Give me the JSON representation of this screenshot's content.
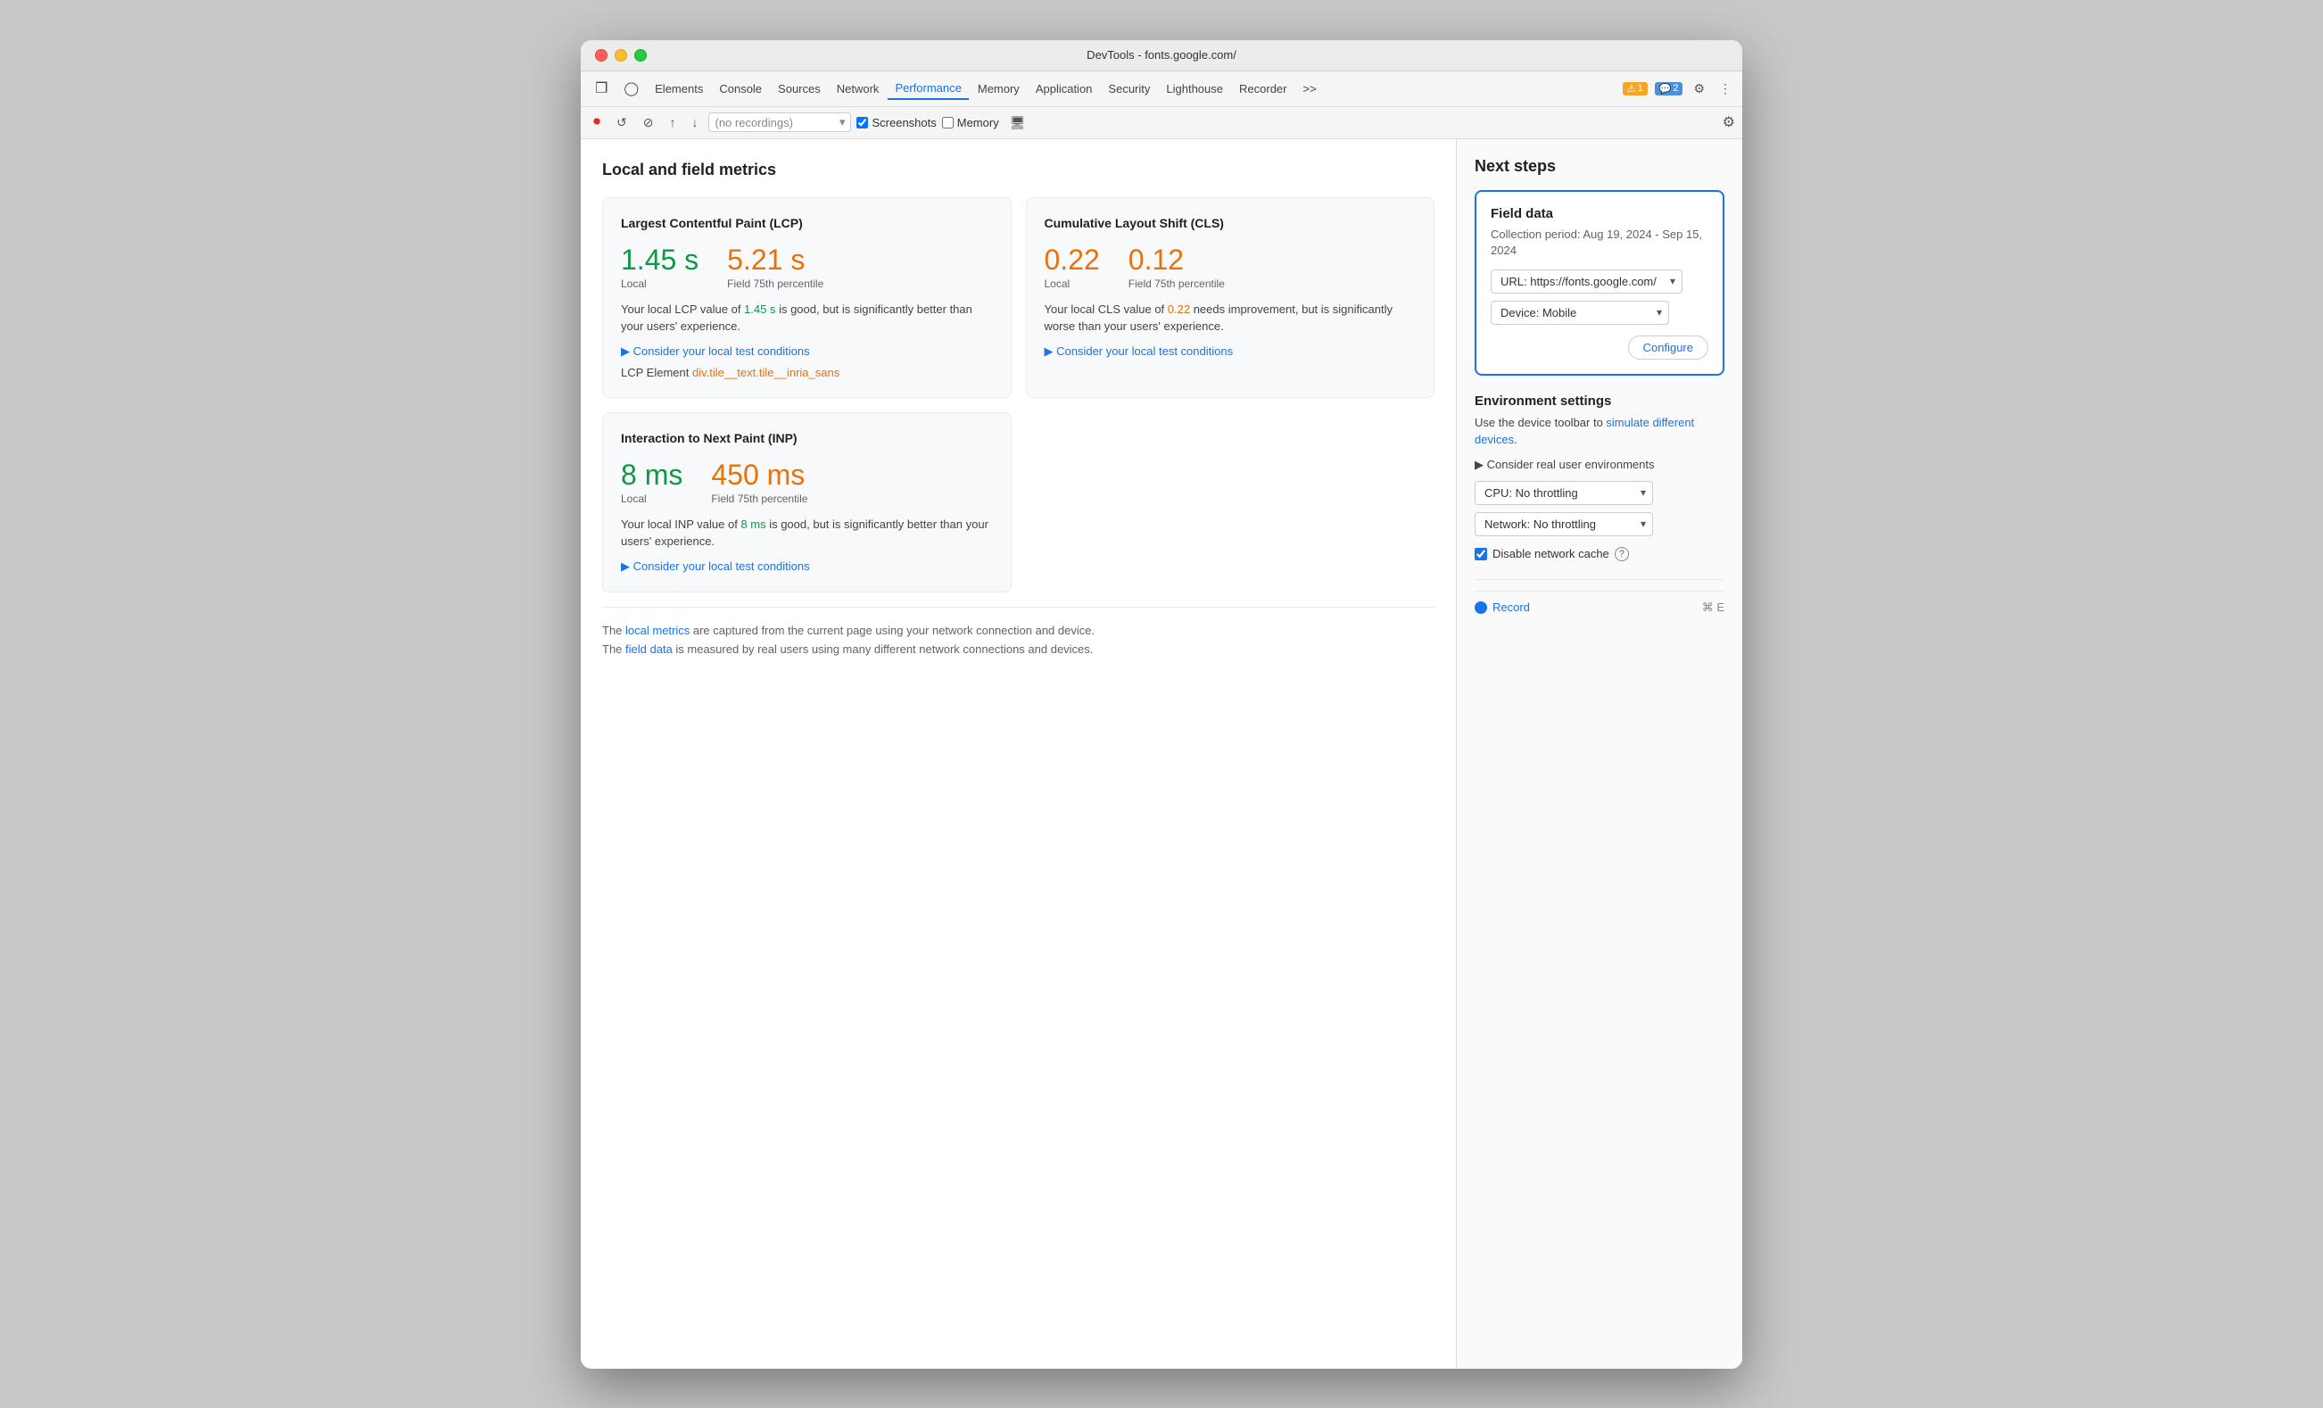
{
  "window": {
    "title": "DevTools - fonts.google.com/"
  },
  "titlebar": {
    "title": "DevTools - fonts.google.com/"
  },
  "toolbar": {
    "tabs": [
      {
        "id": "elements",
        "label": "Elements",
        "active": false
      },
      {
        "id": "console",
        "label": "Console",
        "active": false
      },
      {
        "id": "sources",
        "label": "Sources",
        "active": false
      },
      {
        "id": "network",
        "label": "Network",
        "active": false
      },
      {
        "id": "performance",
        "label": "Performance",
        "active": true
      },
      {
        "id": "memory",
        "label": "Memory",
        "active": false
      },
      {
        "id": "application",
        "label": "Application",
        "active": false
      },
      {
        "id": "security",
        "label": "Security",
        "active": false
      },
      {
        "id": "lighthouse",
        "label": "Lighthouse",
        "active": false
      },
      {
        "id": "recorder",
        "label": "Recorder",
        "active": false
      }
    ],
    "overflow": ">>",
    "warning_count": "1",
    "info_count": "2"
  },
  "controls": {
    "record_placeholder": "(no recordings)",
    "screenshots_label": "Screenshots",
    "screenshots_checked": true,
    "memory_label": "Memory",
    "memory_checked": false
  },
  "left_panel": {
    "section_title": "Local and field metrics",
    "lcp_card": {
      "title": "Largest Contentful Paint (LCP)",
      "local_value": "1.45 s",
      "local_label": "Local",
      "field_value": "5.21 s",
      "field_label": "Field 75th percentile",
      "description_start": "Your local LCP value of ",
      "description_highlight": "1.45 s",
      "description_end": " is good, but is significantly better than your users' experience.",
      "expand_label": "▶ Consider your local test conditions",
      "lcp_element_prefix": "LCP Element ",
      "lcp_element_value": "div.tile__text.tile__inria_sans"
    },
    "cls_card": {
      "title": "Cumulative Layout Shift (CLS)",
      "local_value": "0.22",
      "local_label": "Local",
      "field_value": "0.12",
      "field_label": "Field 75th percentile",
      "description_start": "Your local CLS value of ",
      "description_highlight": "0.22",
      "description_end": " needs improvement, but is significantly worse than your users' experience.",
      "expand_label": "▶ Consider your local test conditions"
    },
    "inp_card": {
      "title": "Interaction to Next Paint (INP)",
      "local_value": "8 ms",
      "local_label": "Local",
      "field_value": "450 ms",
      "field_label": "Field 75th percentile",
      "description_start": "Your local INP value of ",
      "description_highlight": "8 ms",
      "description_end": " is good, but is significantly better than your users' experience.",
      "expand_label": "▶ Consider your local test conditions"
    },
    "footer": {
      "line1_start": "The ",
      "local_metrics_link": "local metrics",
      "line1_end": " are captured from the current page using your network connection and device.",
      "line2_start": "The ",
      "field_data_link": "field data",
      "line2_end": " is measured by real users using many different network connections and devices."
    }
  },
  "right_panel": {
    "title": "Next steps",
    "field_data": {
      "title": "Field data",
      "period": "Collection period: Aug 19, 2024 - Sep 15, 2024",
      "url_label": "URL: https://fonts.google.com/",
      "device_label": "Device: Mobile",
      "configure_label": "Configure"
    },
    "environment": {
      "title": "Environment settings",
      "description": "Use the device toolbar to ",
      "simulate_link": "simulate different devices",
      "description_end": ".",
      "expand_label": "▶ Consider real user environments",
      "cpu_label": "CPU: No throttling",
      "network_label": "Network: No throttling",
      "disable_cache_label": "Disable network cache"
    },
    "record": {
      "label": "Record",
      "shortcut": "⌘ E"
    }
  }
}
